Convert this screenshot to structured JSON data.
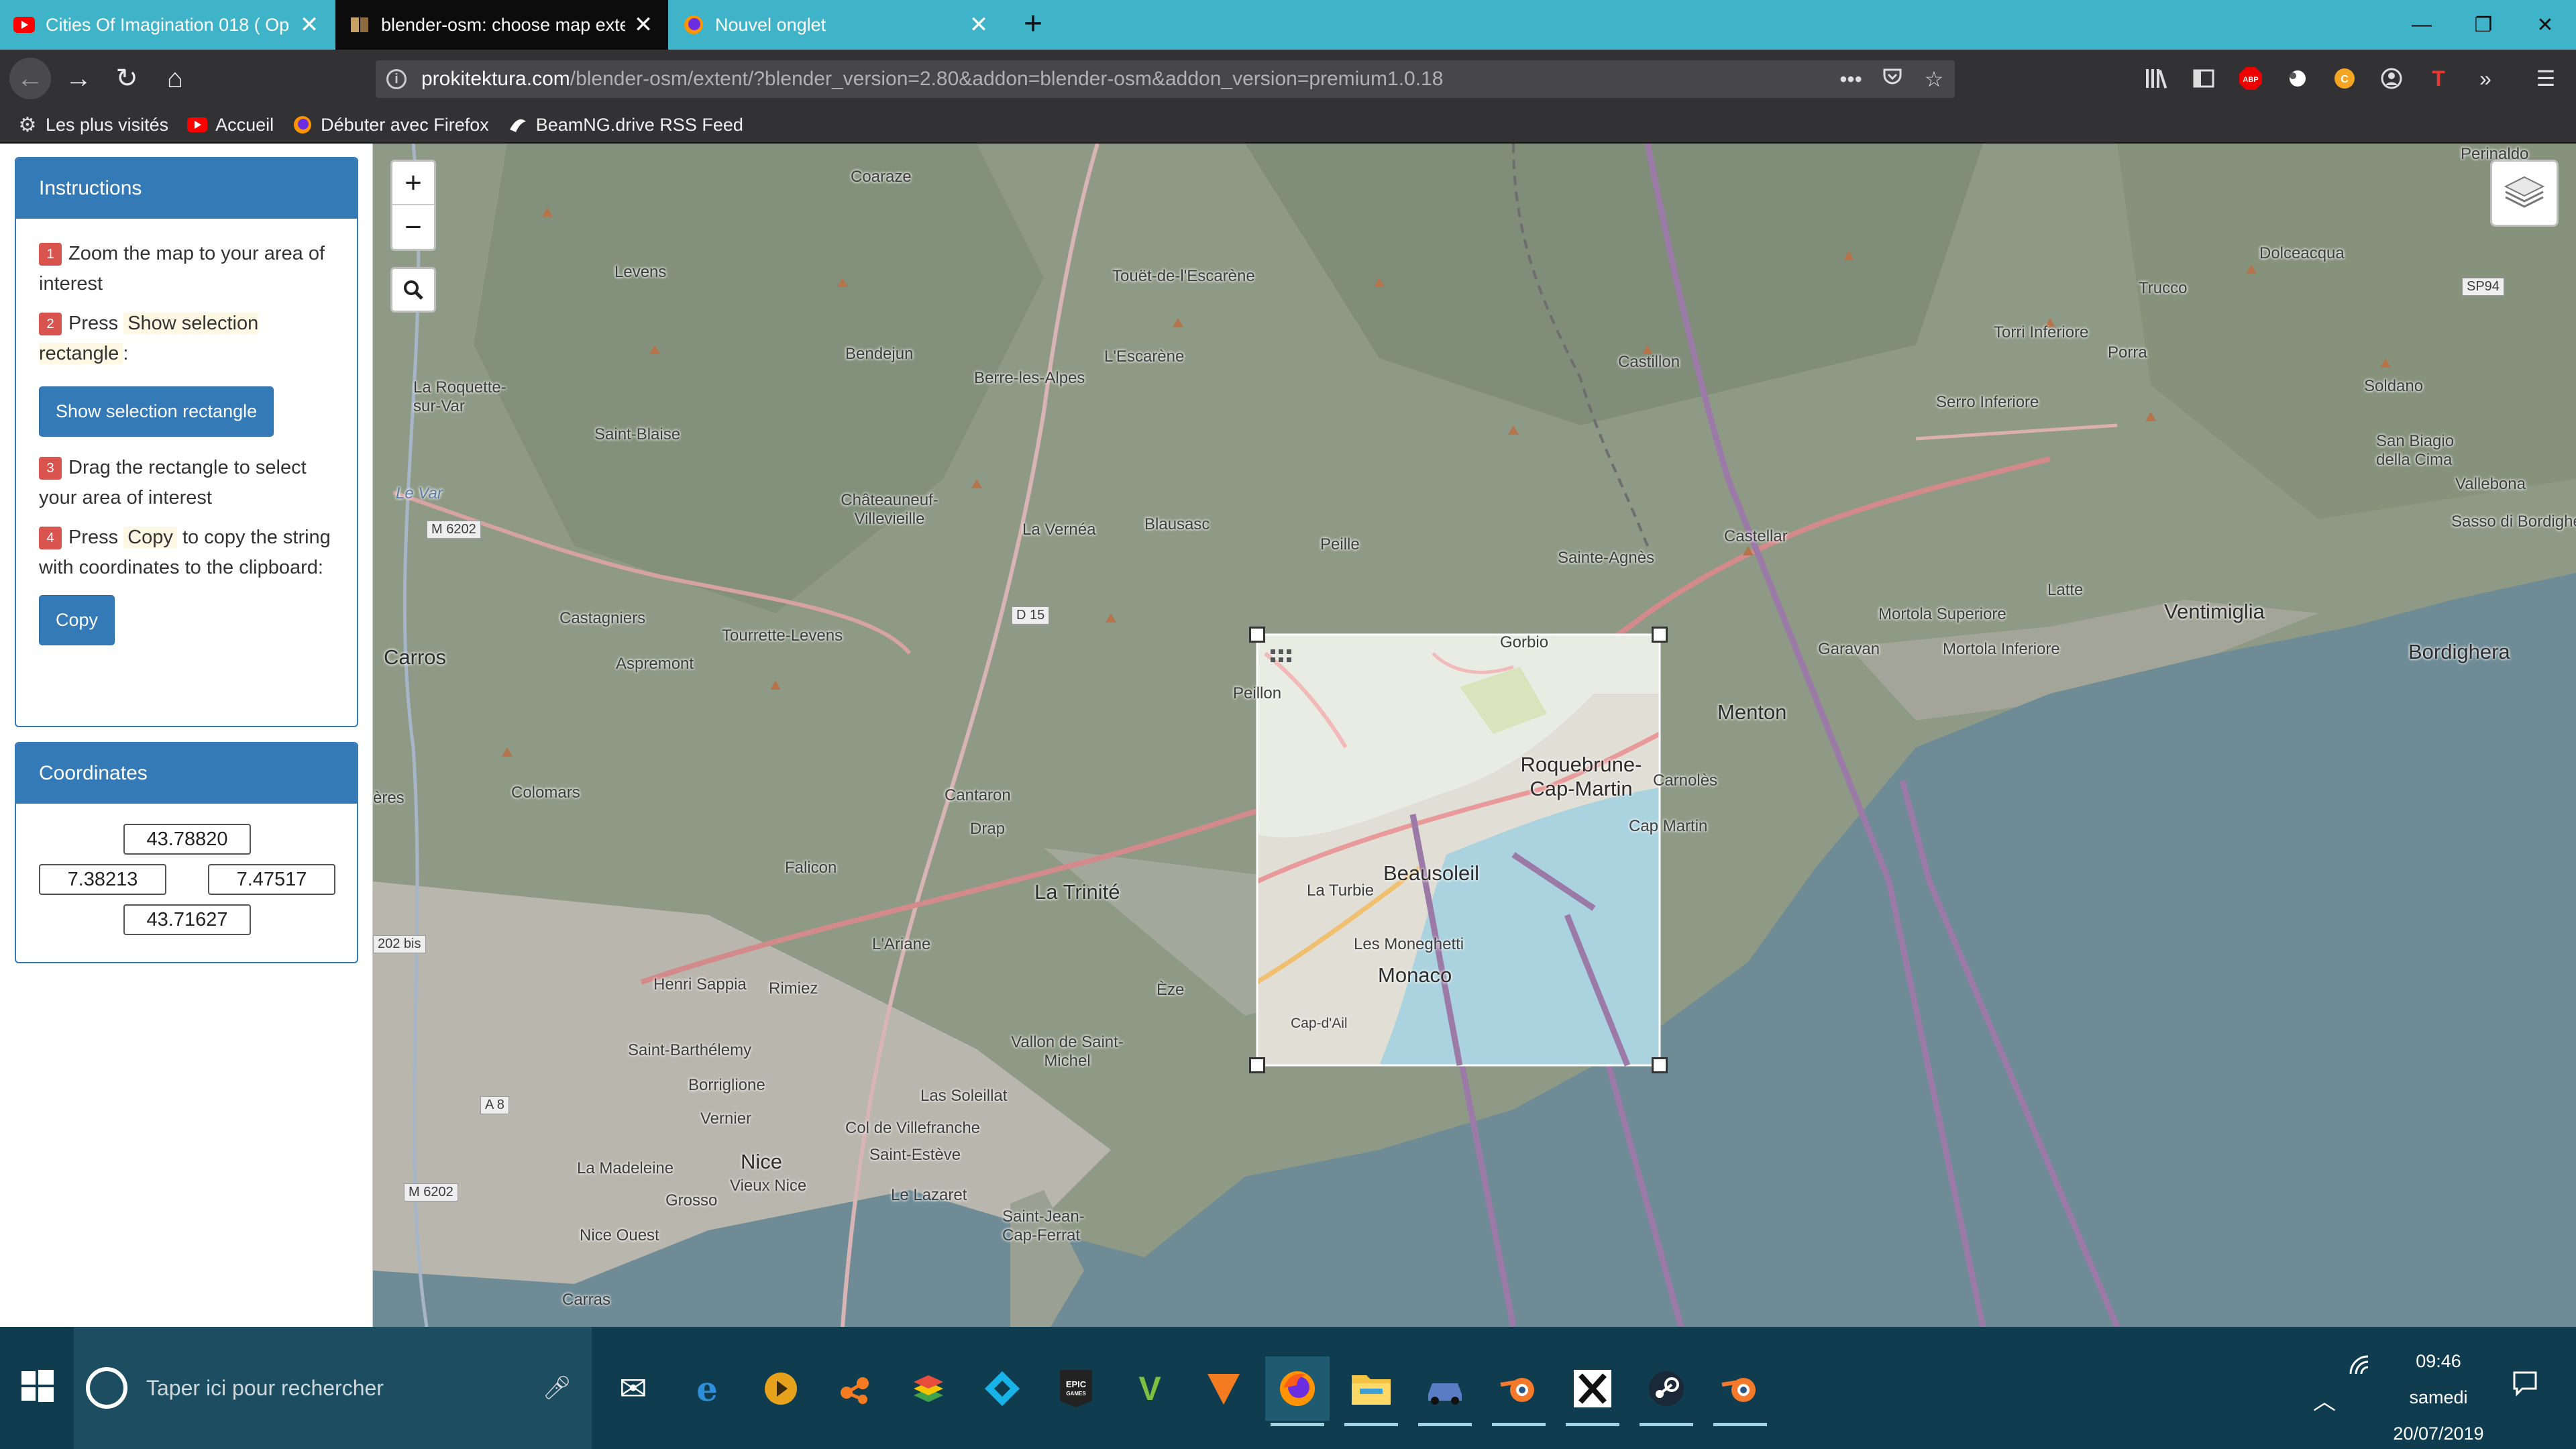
{
  "tabs": [
    {
      "title": "Cities Of Imagination 018 ( Op",
      "icon": "youtube-icon",
      "active": false
    },
    {
      "title": "blender-osm: choose map exte",
      "icon": "blender-osm-icon",
      "active": true
    },
    {
      "title": "Nouvel onglet",
      "icon": "firefox-icon",
      "active": false
    }
  ],
  "navbar": {
    "url_host": "prokitektura.com",
    "url_path": "/blender-osm/extent/?blender_version=2.80&addon=blender-osm&addon_version=premium1.0.18"
  },
  "bookmarks": [
    {
      "label": "Les plus visités",
      "icon": "gear-icon"
    },
    {
      "label": "Accueil",
      "icon": "youtube-icon"
    },
    {
      "label": "Débuter avec Firefox",
      "icon": "firefox-icon"
    },
    {
      "label": "BeamNG.drive RSS Feed",
      "icon": "beamng-icon"
    }
  ],
  "instructions": {
    "title": "Instructions",
    "steps": [
      {
        "num": "1",
        "text": "Zoom the map to your area of interest"
      },
      {
        "num": "2",
        "pre": "Press",
        "highlight": "Show selection rectangle",
        "post": ":"
      },
      {
        "num": "3",
        "text": "Drag the rectangle to select your area of interest"
      },
      {
        "num": "4",
        "pre": "Press",
        "highlight": "Copy",
        "post": "to copy the string with coordinates to the clipboard:"
      }
    ],
    "show_button": "Show selection rectangle",
    "copy_button": "Copy"
  },
  "coordinates": {
    "title": "Coordinates",
    "north": "43.78820",
    "west": "7.38213",
    "east": "7.47517",
    "south": "43.71627"
  },
  "map": {
    "zoom_in": "+",
    "zoom_out": "−",
    "labels": {
      "coaraze": "Coaraze",
      "levens": "Levens",
      "touet": "Touët-de-l'Escarène",
      "bendejun": "Bendejun",
      "lescarene": "L'Escarène",
      "berre": "Berre-les-Alpes",
      "castillon": "Castillon",
      "laroquette": "La Roquette-sur-Var",
      "saintblaise": "Saint-Blaise",
      "levar": "Le Var",
      "chateauneuf": "Châteauneuf-Villevieille",
      "lavernea": "La Vernéa",
      "blausasc": "Blausasc",
      "peille": "Peille",
      "saintagnes": "Sainte-Agnès",
      "castellar": "Castellar",
      "castagniers": "Castagniers",
      "tourrette": "Tourrette-Levens",
      "aspremont": "Aspremont",
      "carros": "Carros",
      "peillon": "Peillon",
      "gorbio": "Gorbio",
      "menton": "Menton",
      "roquebrune": "Roquebrune-Cap-Martin",
      "carnoles": "Carnolès",
      "capmartin": "Cap Martin",
      "colomars": "Colomars",
      "cantaron": "Cantaron",
      "drap": "Drap",
      "falicon": "Falicon",
      "latrinite": "La Trinité",
      "beausoleil": "Beausoleil",
      "laturbie": "La Turbie",
      "lesmoneghetti": "Les Moneghetti",
      "monaco": "Monaco",
      "capdail": "Cap-d'Ail",
      "lariane": "L'Ariane",
      "henrisappia": "Henri Sappia",
      "rimiez": "Rimiez",
      "eze": "Èze",
      "saintbarth": "Saint-Barthélemy",
      "borrigl": "Borriglione",
      "vallon": "Vallon de Saint-Michel",
      "lasoleillat": "Las Soleillat",
      "vernier": "Vernier",
      "colvillef": "Col de Villefranche",
      "lamadeleine": "La Madeleine",
      "nice": "Nice",
      "vieuxnice": "Vieux Nice",
      "saintestev": "Saint-Estève",
      "grosso": "Grosso",
      "lelazaret": "Le Lazaret",
      "stjean": "Saint-Jean-Cap-Ferrat",
      "niceouest": "Nice Ouest",
      "carras": "Carras",
      "peirnaldo": "Perinaldo",
      "dolceacqua": "Dolceacqua",
      "trucco": "Trucco",
      "torri": "Torri Inferiore",
      "porra": "Porra",
      "soldano": "Soldano",
      "serro": "Serro Inferiore",
      "sanbiagio": "San Biagio della Cima",
      "vallebona": "Vallebona",
      "sasso": "Sasso di Bordighera",
      "latte": "Latte",
      "mortolasup": "Mortola Superiore",
      "mortolainf": "Mortola Inferiore",
      "ventimiglia": "Ventimiglia",
      "grimaldi": "Garavan",
      "bordighera": "Bordighera",
      "m6202a": "M 6202",
      "m6202b": "M 6202",
      "d15": "D 15",
      "sp94": "SP94",
      "a8": "A 8",
      "bis": "202 bis",
      "eres": "ères"
    }
  },
  "taskbar": {
    "search_placeholder": "Taper ici pour rechercher",
    "time": "09:46",
    "day": "samedi",
    "date": "20/07/2019"
  }
}
